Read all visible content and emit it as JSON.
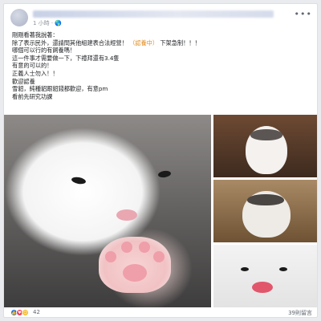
{
  "post": {
    "meta_time": "1 小時 · 🌎",
    "more_label": "•••",
    "text_lines": [
      "剛剛看著我說著：",
      "除了表示民外，還請問其他組建表合法經營！",
      "哪個可以行的有飼養嗎！",
      "這一件事才需要做一下，下禮拜還有3.4隻",
      "有意的可以的！",
      "正義人士勿入！！",
      "歡迎認養",
      "雪貂，純種貂跟貂錢都歡迎，有意pm",
      "看前先研究功課"
    ],
    "highlight_text": "（認養中）",
    "highlight_suffix": "下架急制！！！"
  },
  "reactions": {
    "count": "42",
    "shares": "39則留言"
  },
  "colors": {
    "accent": "#1877f2",
    "highlight": "#e08a1e"
  }
}
